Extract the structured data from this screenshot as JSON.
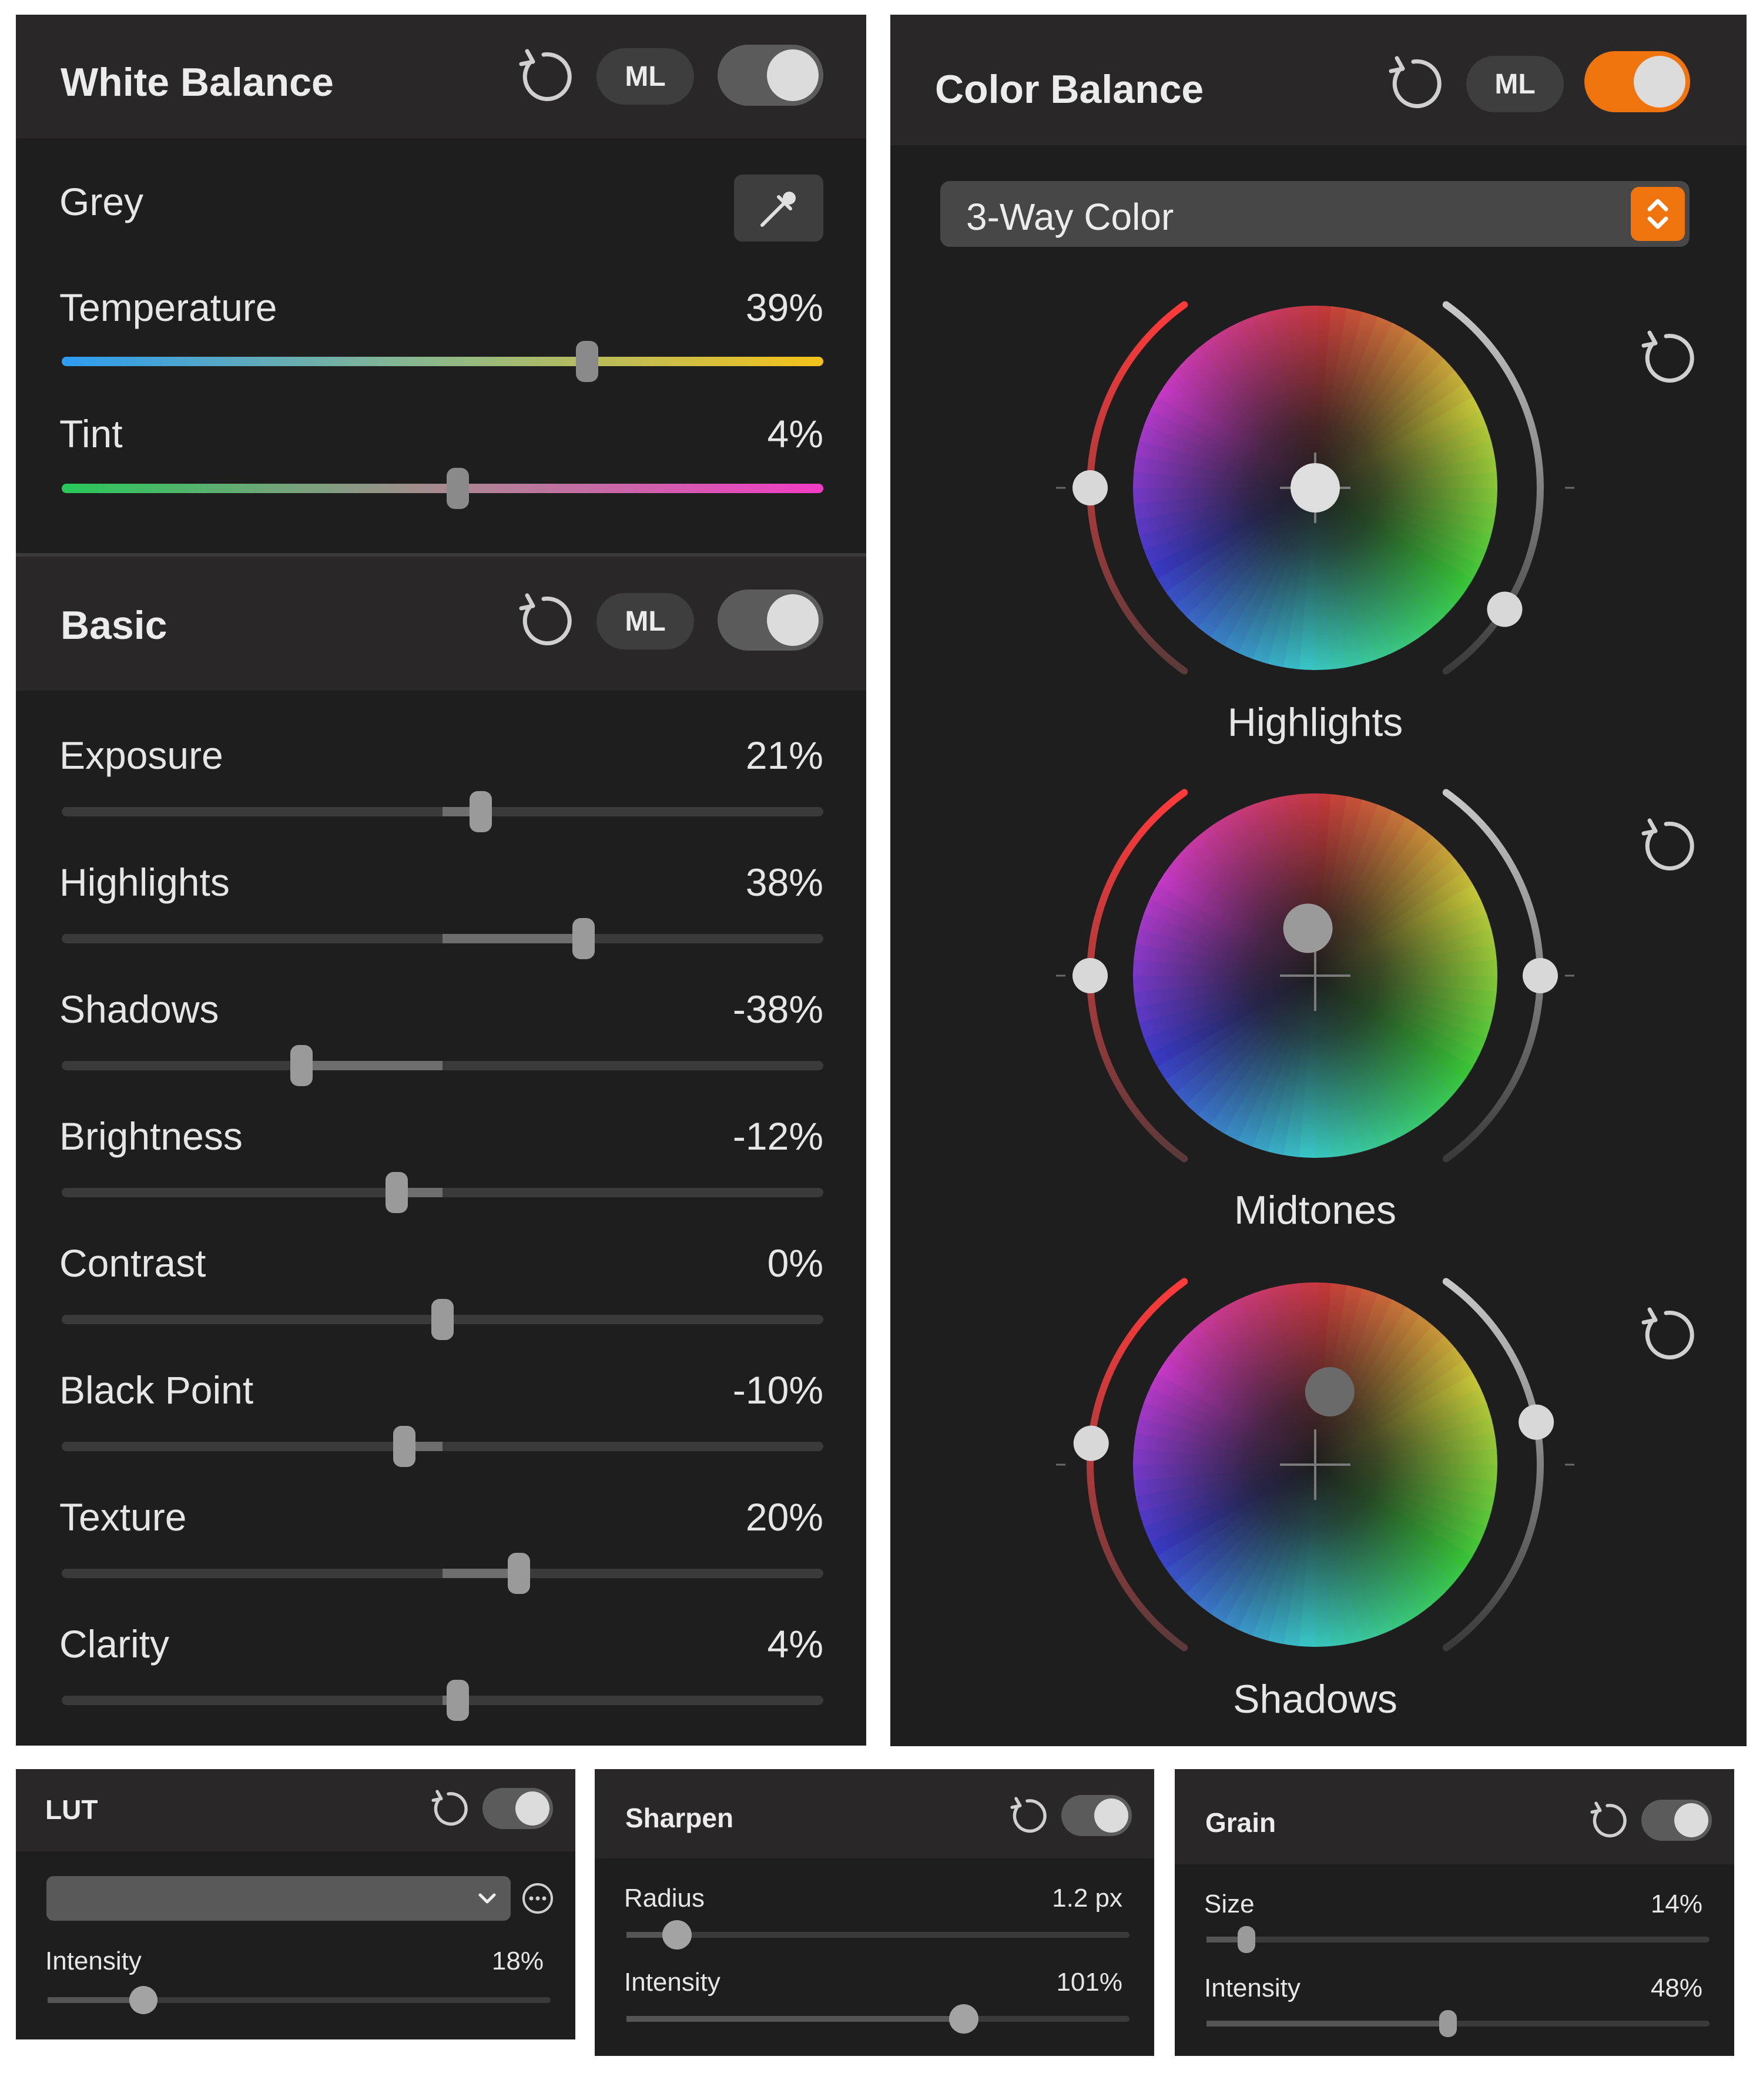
{
  "white_balance": {
    "title": "White Balance",
    "ml_label": "ML",
    "enabled": true,
    "grey_label": "Grey",
    "sliders": [
      {
        "label": "Temperature",
        "value_text": "39%",
        "position": 0.69
      },
      {
        "label": "Tint",
        "value_text": "4%",
        "position": 0.52
      }
    ]
  },
  "basic": {
    "title": "Basic",
    "ml_label": "ML",
    "enabled": true,
    "sliders": [
      {
        "label": "Exposure",
        "value_text": "21%",
        "position": 0.55
      },
      {
        "label": "Highlights",
        "value_text": "38%",
        "position": 0.685
      },
      {
        "label": "Shadows",
        "value_text": "-38%",
        "position": 0.315
      },
      {
        "label": "Brightness",
        "value_text": "-12%",
        "position": 0.44
      },
      {
        "label": "Contrast",
        "value_text": "0%",
        "position": 0.5
      },
      {
        "label": "Black Point",
        "value_text": "-10%",
        "position": 0.45
      },
      {
        "label": "Texture",
        "value_text": "20%",
        "position": 0.6
      },
      {
        "label": "Clarity",
        "value_text": "4%",
        "position": 0.52
      }
    ]
  },
  "color_balance": {
    "title": "Color Balance",
    "ml_label": "ML",
    "enabled": true,
    "mode": "3-Way Color",
    "wheels": [
      {
        "label": "Highlights",
        "left_level": 0.5,
        "right_level": 0.8,
        "puck_offset": [
          0,
          0
        ]
      },
      {
        "label": "Midtones",
        "left_level": 0.5,
        "right_level": 0.5,
        "puck_offset": [
          -0.02,
          0.13
        ]
      },
      {
        "label": "Shadows",
        "left_level": 0.45,
        "right_level": 0.4,
        "puck_offset": [
          0.04,
          0.2
        ]
      }
    ]
  },
  "lut": {
    "title": "LUT",
    "enabled": true,
    "selected": "",
    "sliders": [
      {
        "label": "Intensity",
        "value_text": "18%",
        "position": 0.19
      }
    ]
  },
  "sharpen": {
    "title": "Sharpen",
    "enabled": true,
    "sliders": [
      {
        "label": "Radius",
        "value_text": "1.2 px",
        "position": 0.1
      },
      {
        "label": "Intensity",
        "value_text": "101%",
        "position": 0.67
      }
    ]
  },
  "grain": {
    "title": "Grain",
    "enabled": true,
    "sliders": [
      {
        "label": "Size",
        "value_text": "14%",
        "position": 0.08
      },
      {
        "label": "Intensity",
        "value_text": "48%",
        "position": 0.48
      }
    ]
  },
  "colors": {
    "panel_bg": "#1e1e1e",
    "header_bg": "#292727",
    "accent": "#f0740e",
    "temperature_gradient": [
      "#2d9cf0",
      "#8fb887",
      "#f5c21a"
    ],
    "tint_gradient": [
      "#28c85a",
      "#a88a90",
      "#f23cc4"
    ]
  },
  "icons": {
    "reset": "reset-arrow-icon",
    "eyedropper": "eyedropper-icon",
    "dropdown": "chevron-updown-icon",
    "more": "ellipsis-circle-icon"
  }
}
